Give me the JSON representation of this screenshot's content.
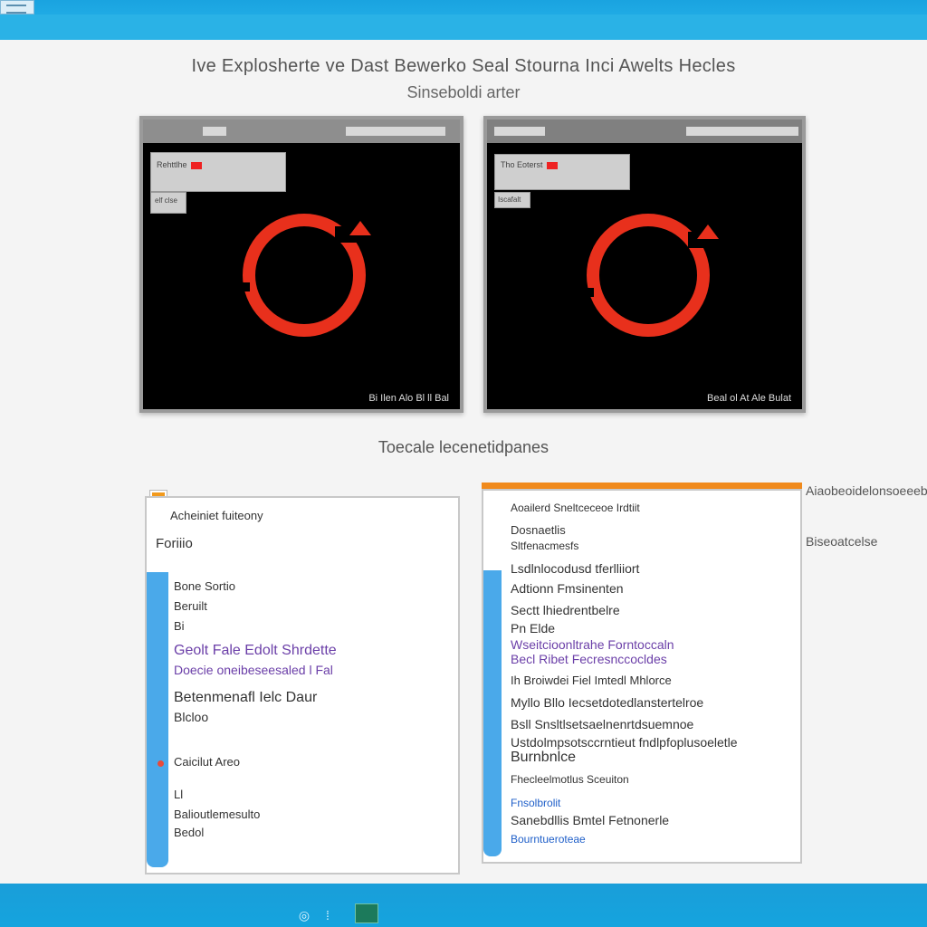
{
  "window": {
    "title_text": ""
  },
  "header": {
    "title": "Ive Explosherte ve Dast Bewerko Seal Stourna Inci Awelts Hecles",
    "subtitle": "Sinseboldi arter"
  },
  "previews": [
    {
      "panel_label": "Rehttlhe",
      "panel_sub": "elf clse",
      "status": "Bi Ilen Alo Bl ll Bal"
    },
    {
      "panel_label": "Tho Eoterst",
      "panel_sub": "Iscafalt",
      "status": "Beal ol At Ale Bulat"
    }
  ],
  "section_label": "Toecale lecenetidpanes",
  "panel_left": {
    "rows": [
      "Acheiniet fuiteony",
      "Foriiio",
      "Bone Sortio",
      "Beruilt",
      "Bi",
      "Geolt Fale Edolt Shrdette",
      "Doecie oneibeseesaled l Fal",
      "Betenmenafl Ielc Daur",
      "Blcloo",
      "Caicilut Areo",
      "Ll",
      "Balioutlemesulto",
      "Bedol"
    ]
  },
  "panel_right": {
    "rows": [
      "Aoailerd Sneltceceoe Irdtiit",
      "Dosnaetlis",
      "Sltfenacmesfs",
      "Lsdlnlocodusd tferlliiort",
      "Adtionn Fmsinenten",
      "Sectt lhiedrentbelre",
      "Pn Elde",
      "Wseitcioonltrahe Forntoccaln",
      "Becl Ribet Fecresnccocldes",
      "Ih Broiwdei Fiel Imtedl Mhlorce",
      "Myllo Bllo Iecsetdotedlanstertelroe",
      "Bsll Snsltlsetsaelnenrtdsuemnoe",
      "Burnbnlce",
      "Ustdolmpsotsccrntieut fndlpfoplusoeletle",
      "Fhecleelmotlus Sceuiton",
      "Fnsolbrolit",
      "Sanebdllis Bmtel Fetnonerle",
      "Bourntueroteae"
    ]
  },
  "side_notes": [
    "Aiaobeoidelonsoeeebre",
    "Biseoatcelse"
  ],
  "taskbar": {
    "search_glyph": "◎",
    "task_glyph": "⁞"
  },
  "colors": {
    "accent_blue": "#2ab2e6",
    "ring_red": "#e8301c",
    "orange": "#f08a1c",
    "scroll_blue": "#4aa9ea"
  }
}
